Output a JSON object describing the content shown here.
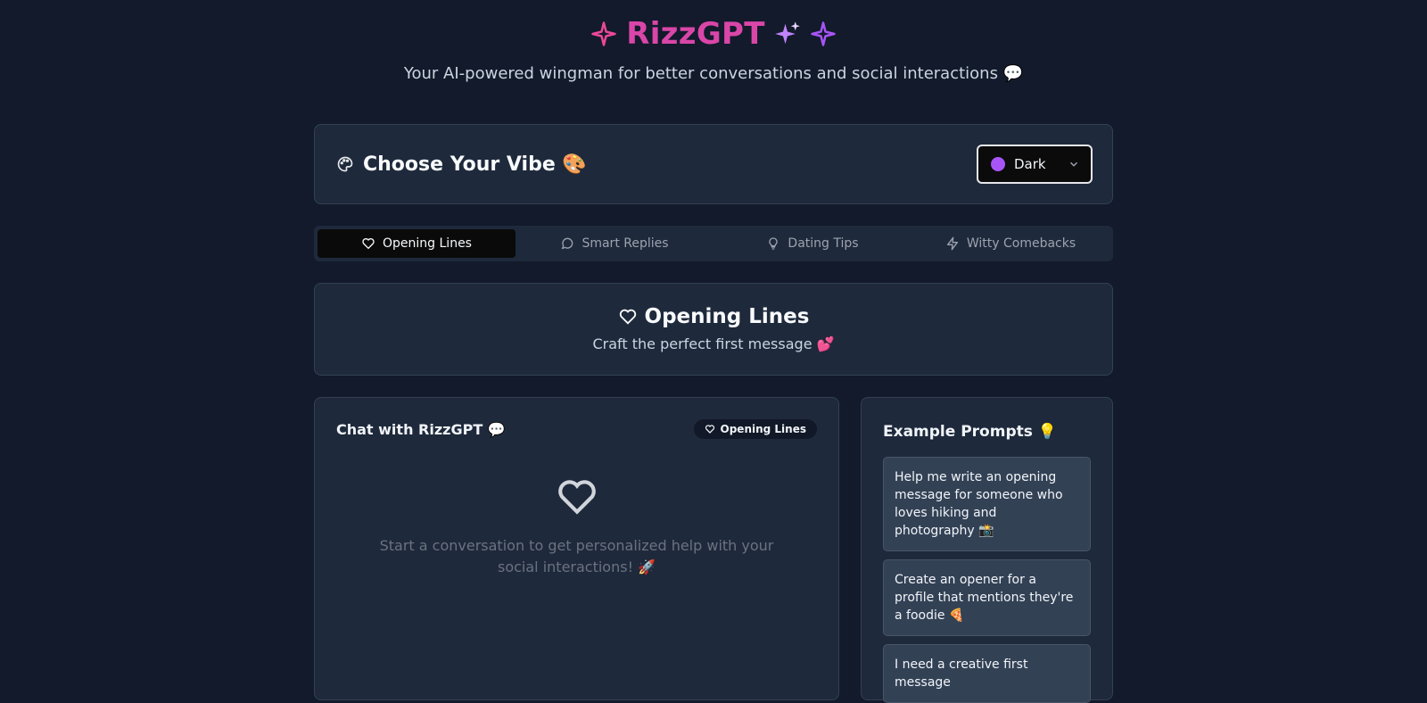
{
  "header": {
    "title": "RizzGPT",
    "subtitle": "Your AI-powered wingman for better conversations and social interactions 💬"
  },
  "vibe": {
    "title": "Choose Your Vibe 🎨",
    "theme_value": "Dark"
  },
  "tabs": [
    {
      "label": "Opening Lines",
      "icon": "heart-icon",
      "active": true
    },
    {
      "label": "Smart Replies",
      "icon": "message-circle-icon",
      "active": false
    },
    {
      "label": "Dating Tips",
      "icon": "lightbulb-icon",
      "active": false
    },
    {
      "label": "Witty Comebacks",
      "icon": "zap-icon",
      "active": false
    }
  ],
  "mode": {
    "title": "Opening Lines",
    "subtitle": "Craft the perfect first message 💕"
  },
  "chat": {
    "title": "Chat with RizzGPT 💬",
    "badge": "Opening Lines",
    "empty_text": "Start a conversation to get personalized help with your social interactions! 🚀"
  },
  "examples": {
    "title": "Example Prompts 💡",
    "items": [
      "Help me write an opening message for someone who loves hiking and photography 📸",
      "Create an opener for a profile that mentions they're a foodie 🍕",
      "I need a creative first message"
    ]
  },
  "colors": {
    "background": "#121a2b",
    "card": "#1e293b",
    "brand_pink": "#d946a8",
    "brand_purple": "#a855f7"
  }
}
